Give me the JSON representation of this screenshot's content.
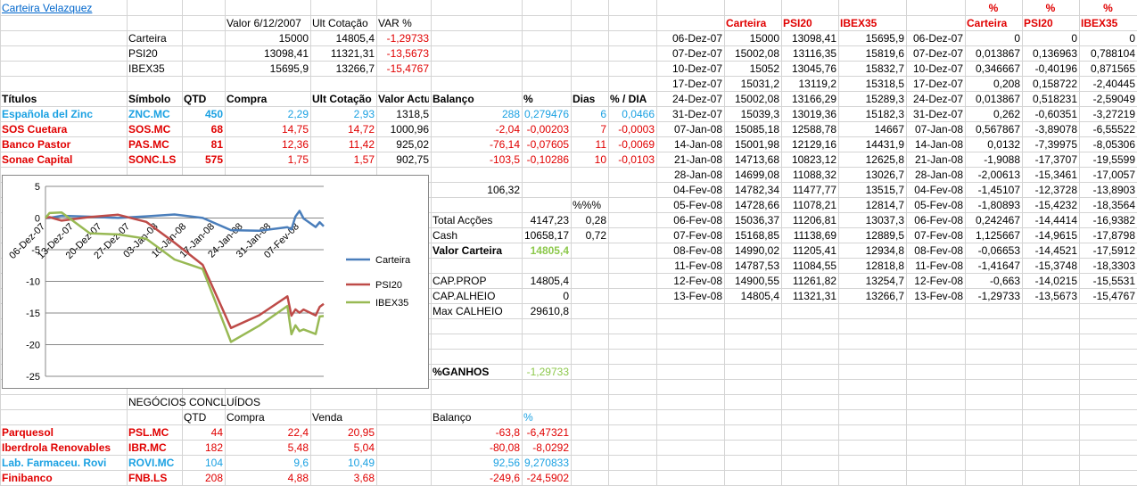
{
  "title": "Carteira Velazquez",
  "summary": {
    "header": [
      "Valor 6/12/2007",
      "Ult Cotação",
      "VAR %"
    ],
    "rows": [
      {
        "label": "Carteira",
        "valor": "15000",
        "ult": "14805,4",
        "var": "-1,29733"
      },
      {
        "label": "PSI20",
        "valor": "13098,41",
        "ult": "11321,31",
        "var": "-13,5673"
      },
      {
        "label": "IBEX35",
        "valor": "15695,9",
        "ult": "13266,7",
        "var": "-15,4767"
      }
    ]
  },
  "holdings": {
    "header": [
      "Títulos",
      "Símbolo",
      "QTD",
      "Compra",
      "Ult Cotação",
      "Valor Actual",
      "Balanço",
      "%",
      "Dias",
      "% / DIA"
    ],
    "rows": [
      {
        "name": "Española del Zinc",
        "sym": "ZNC.MC",
        "qtd": "450",
        "compra": "2,29",
        "ult": "2,93",
        "valor": "1318,5",
        "bal": "288",
        "pct": "0,279476",
        "dias": "6",
        "pd": "0,0466",
        "color": "blue"
      },
      {
        "name": "SOS Cuetara",
        "sym": "SOS.MC",
        "qtd": "68",
        "compra": "14,75",
        "ult": "14,72",
        "valor": "1000,96",
        "bal": "-2,04",
        "pct": "-0,00203",
        "dias": "7",
        "pd": "-0,0003",
        "color": "red"
      },
      {
        "name": "Banco Pastor",
        "sym": "PAS.MC",
        "qtd": "81",
        "compra": "12,36",
        "ult": "11,42",
        "valor": "925,02",
        "bal": "-76,14",
        "pct": "-0,07605",
        "dias": "11",
        "pd": "-0,0069",
        "color": "red"
      },
      {
        "name": "Sonae Capital",
        "sym": "SONC.LS",
        "qtd": "575",
        "compra": "1,75",
        "ult": "1,57",
        "valor": "902,75",
        "bal": "-103,5",
        "pct": "-0,10286",
        "dias": "10",
        "pd": "-0,0103",
        "color": "red"
      }
    ]
  },
  "totals": {
    "sum": "106,32",
    "pctpct": "%%%",
    "total_accoes_label": "Total Acções",
    "total_accoes": "4147,23",
    "total_accoes_pct": "0,28",
    "cash_label": "Cash",
    "cash": "10658,17",
    "cash_pct": "0,72",
    "valor_carteira_label": "Valor Carteira",
    "valor_carteira": "14805,4",
    "cap_prop_label": "CAP.PROP",
    "cap_prop": "14805,4",
    "cap_alheio_label": "CAP.ALHEIO",
    "cap_alheio": "0",
    "max_calheio_label": "Max CALHEIO",
    "max_calheio": "29610,8",
    "ganhos_label": "%GANHOS",
    "ganhos": "-1,29733"
  },
  "closed": {
    "title": "NEGÓCIOS CONCLUÍDOS",
    "header": [
      "QTD",
      "Compra",
      "Venda",
      "Balanço",
      "%"
    ],
    "rows": [
      {
        "name": "Parquesol",
        "sym": "PSL.MC",
        "qtd": "44",
        "compra": "22,4",
        "venda": "20,95",
        "bal": "-63,8",
        "pct": "-6,47321",
        "color": "red"
      },
      {
        "name": "Iberdrola Renovables",
        "sym": "IBR.MC",
        "qtd": "182",
        "compra": "5,48",
        "venda": "5,04",
        "bal": "-80,08",
        "pct": "-8,0292",
        "color": "red"
      },
      {
        "name": "Lab. Farmaceu. Rovi",
        "sym": "ROVI.MC",
        "qtd": "104",
        "compra": "9,6",
        "venda": "10,49",
        "bal": "92,56",
        "pct": "9,270833",
        "color": "blue"
      },
      {
        "name": "Finibanco",
        "sym": "FNB.LS",
        "qtd": "208",
        "compra": "4,88",
        "venda": "3,68",
        "bal": "-249,6",
        "pct": "-24,5902",
        "color": "red"
      }
    ]
  },
  "history": {
    "header": [
      "Carteira",
      "PSI20",
      "IBEX35"
    ],
    "rows": [
      {
        "d": "06-Dez-07",
        "c": "15000",
        "p": "13098,41",
        "i": "15695,9"
      },
      {
        "d": "07-Dez-07",
        "c": "15002,08",
        "p": "13116,35",
        "i": "15819,6"
      },
      {
        "d": "10-Dez-07",
        "c": "15052",
        "p": "13045,76",
        "i": "15832,7"
      },
      {
        "d": "17-Dez-07",
        "c": "15031,2",
        "p": "13119,2",
        "i": "15318,5"
      },
      {
        "d": "24-Dez-07",
        "c": "15002,08",
        "p": "13166,29",
        "i": "15289,3"
      },
      {
        "d": "31-Dez-07",
        "c": "15039,3",
        "p": "13019,36",
        "i": "15182,3"
      },
      {
        "d": "07-Jan-08",
        "c": "15085,18",
        "p": "12588,78",
        "i": "14667"
      },
      {
        "d": "14-Jan-08",
        "c": "15001,98",
        "p": "12129,16",
        "i": "14431,9"
      },
      {
        "d": "21-Jan-08",
        "c": "14713,68",
        "p": "10823,12",
        "i": "12625,8"
      },
      {
        "d": "28-Jan-08",
        "c": "14699,08",
        "p": "11088,32",
        "i": "13026,7"
      },
      {
        "d": "04-Fev-08",
        "c": "14782,34",
        "p": "11477,77",
        "i": "13515,7"
      },
      {
        "d": "05-Fev-08",
        "c": "14728,66",
        "p": "11078,21",
        "i": "12814,7"
      },
      {
        "d": "06-Fev-08",
        "c": "15036,37",
        "p": "11206,81",
        "i": "13037,3"
      },
      {
        "d": "07-Fev-08",
        "c": "15168,85",
        "p": "11138,69",
        "i": "12889,5"
      },
      {
        "d": "08-Fev-08",
        "c": "14990,02",
        "p": "11205,41",
        "i": "12934,8"
      },
      {
        "d": "11-Fev-08",
        "c": "14787,53",
        "p": "11084,55",
        "i": "12818,8"
      },
      {
        "d": "12-Fev-08",
        "c": "14900,55",
        "p": "11261,82",
        "i": "13254,7"
      },
      {
        "d": "13-Fev-08",
        "c": "14805,4",
        "p": "11321,31",
        "i": "13266,7"
      }
    ]
  },
  "variation": {
    "pct_label": "%",
    "header": [
      "Carteira",
      "PSI20",
      "IBEX35"
    ],
    "rows": [
      {
        "d": "06-Dez-07",
        "c": "0",
        "p": "0",
        "i": "0"
      },
      {
        "d": "07-Dez-07",
        "c": "0,013867",
        "p": "0,136963",
        "i": "0,788104"
      },
      {
        "d": "10-Dez-07",
        "c": "0,346667",
        "p": "-0,40196",
        "i": "0,871565"
      },
      {
        "d": "17-Dez-07",
        "c": "0,208",
        "p": "0,158722",
        "i": "-2,40445"
      },
      {
        "d": "24-Dez-07",
        "c": "0,013867",
        "p": "0,518231",
        "i": "-2,59049"
      },
      {
        "d": "31-Dez-07",
        "c": "0,262",
        "p": "-0,60351",
        "i": "-3,27219"
      },
      {
        "d": "07-Jan-08",
        "c": "0,567867",
        "p": "-3,89078",
        "i": "-6,55522"
      },
      {
        "d": "14-Jan-08",
        "c": "0,0132",
        "p": "-7,39975",
        "i": "-8,05306"
      },
      {
        "d": "21-Jan-08",
        "c": "-1,9088",
        "p": "-17,3707",
        "i": "-19,5599"
      },
      {
        "d": "28-Jan-08",
        "c": "-2,00613",
        "p": "-15,3461",
        "i": "-17,0057"
      },
      {
        "d": "04-Fev-08",
        "c": "-1,45107",
        "p": "-12,3728",
        "i": "-13,8903"
      },
      {
        "d": "05-Fev-08",
        "c": "-1,80893",
        "p": "-15,4232",
        "i": "-18,3564"
      },
      {
        "d": "06-Fev-08",
        "c": "0,242467",
        "p": "-14,4414",
        "i": "-16,9382"
      },
      {
        "d": "07-Fev-08",
        "c": "1,125667",
        "p": "-14,9615",
        "i": "-17,8798"
      },
      {
        "d": "08-Fev-08",
        "c": "-0,06653",
        "p": "-14,4521",
        "i": "-17,5912"
      },
      {
        "d": "11-Fev-08",
        "c": "-1,41647",
        "p": "-15,3748",
        "i": "-18,3303"
      },
      {
        "d": "12-Fev-08",
        "c": "-0,663",
        "p": "-14,0215",
        "i": "-15,5531"
      },
      {
        "d": "13-Fev-08",
        "c": "-1,29733",
        "p": "-13,5673",
        "i": "-15,4767"
      }
    ]
  },
  "chart_data": {
    "type": "line",
    "x": [
      "06-Dez-07",
      "07-Dez-07",
      "10-Dez-07",
      "17-Dez-07",
      "24-Dez-07",
      "31-Dez-07",
      "07-Jan-08",
      "14-Jan-08",
      "21-Jan-08",
      "28-Jan-08",
      "04-Fev-08",
      "05-Fev-08",
      "06-Fev-08",
      "07-Fev-08",
      "08-Fev-08",
      "11-Fev-08",
      "12-Fev-08",
      "13-Fev-08"
    ],
    "xticks": [
      "06-Dez-07",
      "13-Dez-07",
      "20-Dez-07",
      "27-Dez-07",
      "03-Jan-08",
      "10-Jan-08",
      "17-Jan-08",
      "24-Jan-08",
      "31-Jan-08",
      "07-Fev-08"
    ],
    "yticks": [
      "5",
      "0",
      "-5",
      "-10",
      "-15",
      "-20",
      "-25"
    ],
    "ylim": [
      -25,
      5
    ],
    "legend_position": "right",
    "series": [
      {
        "name": "Carteira",
        "color": "#4a7ebb",
        "values": [
          0,
          0.013867,
          0.346667,
          0.208,
          0.013867,
          0.262,
          0.567867,
          0.0132,
          -1.9088,
          -2.00613,
          -1.45107,
          -1.80893,
          0.242467,
          1.125667,
          -0.06653,
          -1.41647,
          -0.663,
          -1.29733
        ]
      },
      {
        "name": "PSI20",
        "color": "#be4b48",
        "values": [
          0,
          0.136963,
          -0.40196,
          0.158722,
          0.518231,
          -0.60351,
          -3.89078,
          -7.39975,
          -17.3707,
          -15.3461,
          -12.3728,
          -15.4232,
          -14.4414,
          -14.9615,
          -14.4521,
          -15.3748,
          -14.0215,
          -13.5673
        ]
      },
      {
        "name": "IBEX35",
        "color": "#98b954",
        "values": [
          0,
          0.788104,
          0.871565,
          -2.40445,
          -2.59049,
          -3.27219,
          -6.55522,
          -8.05306,
          -19.5599,
          -17.0057,
          -13.8903,
          -18.3564,
          -16.9382,
          -17.8798,
          -17.5912,
          -18.3303,
          -15.5531,
          -15.4767
        ]
      }
    ]
  }
}
